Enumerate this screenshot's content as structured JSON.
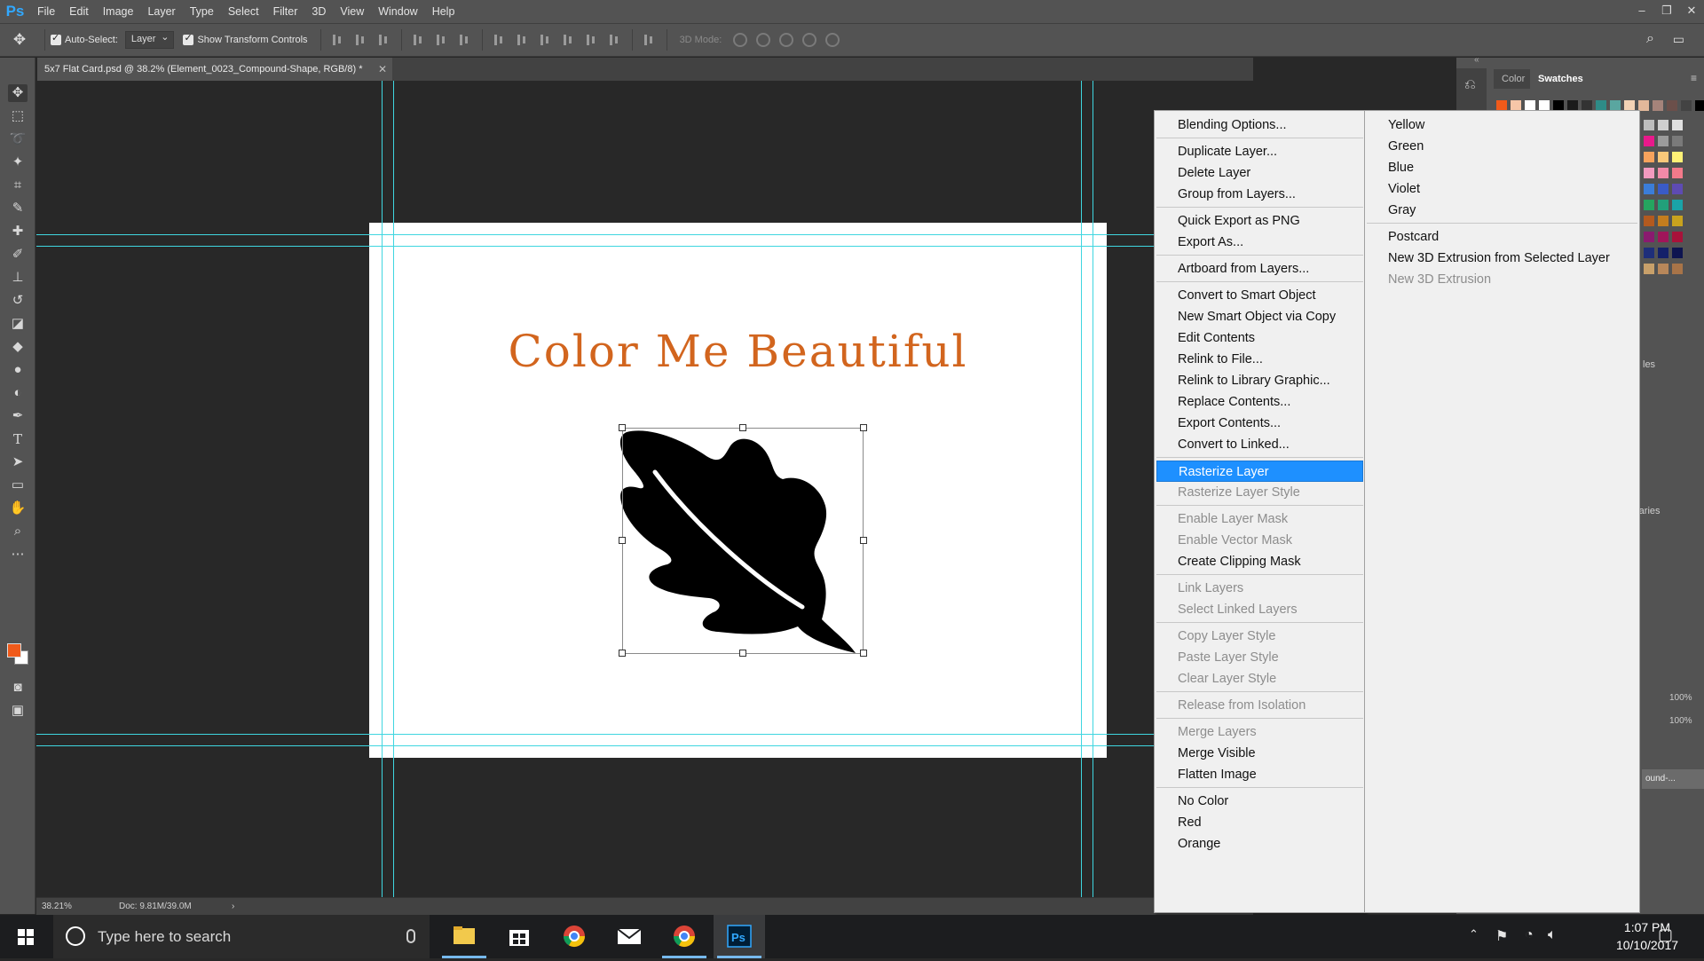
{
  "app": {
    "logo": "Ps"
  },
  "menubar": [
    "File",
    "Edit",
    "Image",
    "Layer",
    "Type",
    "Select",
    "Filter",
    "3D",
    "View",
    "Window",
    "Help"
  ],
  "options": {
    "auto_select_label": "Auto-Select:",
    "auto_select_value": "Layer",
    "transform_label": "Show Transform Controls",
    "mode_3d_label": "3D Mode:"
  },
  "document": {
    "tab_title": "5x7 Flat Card.psd @ 38.2% (Element_0023_Compound-Shape, RGB/8) *",
    "card_title": "Color Me Beautiful"
  },
  "status": {
    "zoom": "38.21%",
    "doc": "Doc: 9.81M/39.0M"
  },
  "panels": {
    "tab_color": "Color",
    "tab_swatches": "Swatches",
    "opacity": "100%",
    "fill": "100%",
    "layer_name_fragment": "ound-..."
  },
  "context_menu": {
    "items": [
      "Blending Options...",
      "Duplicate Layer...",
      "Delete Layer",
      "Group from Layers...",
      "Quick Export as PNG",
      "Export As...",
      "Artboard from Layers...",
      "Convert to Smart Object",
      "New Smart Object via Copy",
      "Edit Contents",
      "Relink to File...",
      "Relink to Library Graphic...",
      "Replace Contents...",
      "Export Contents...",
      "Convert to Linked...",
      "Rasterize Layer",
      "Rasterize Layer Style",
      "Enable Layer Mask",
      "Enable Vector Mask",
      "Create Clipping Mask",
      "Link Layers",
      "Select Linked Layers",
      "Copy Layer Style",
      "Paste Layer Style",
      "Clear Layer Style",
      "Release from Isolation",
      "Merge Layers",
      "Merge Visible",
      "Flatten Image",
      "No Color",
      "Red",
      "Orange"
    ],
    "highlighted": "Rasterize Layer"
  },
  "submenu": {
    "items": [
      "Yellow",
      "Green",
      "Blue",
      "Violet",
      "Gray",
      "Postcard",
      "New 3D Extrusion from Selected Layer",
      "New 3D Extrusion"
    ]
  },
  "taskbar": {
    "search_placeholder": "Type here to search",
    "time": "1:07 PM",
    "date": "10/10/2017"
  },
  "colors": {
    "foreground": "#f05a1a",
    "background": "#ffffff",
    "title_orange": "#d2651e",
    "guides": "#3fd6e0",
    "menu_highlight": "#1e90ff"
  }
}
